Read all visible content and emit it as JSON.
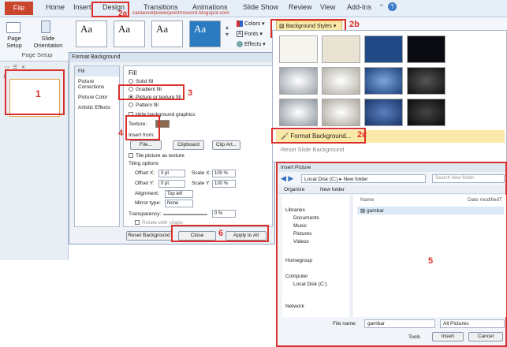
{
  "tabs": [
    "File",
    "Home",
    "Insert",
    "Design",
    "Transitions",
    "Animations",
    "Slide Show",
    "Review",
    "View",
    "Add-Ins"
  ],
  "watermark": "caraexcelpowerpointmsword.blogspot.com",
  "ribbon": {
    "page_setup": "Page\nSetup",
    "slide_orientation": "Slide\nOrientation",
    "group_label": "Page Setup",
    "theme_label": "Aa",
    "colors": "Colors",
    "fonts": "Fonts",
    "effects": "Effects",
    "bg_styles": "Background Styles"
  },
  "labels": {
    "l1": "1",
    "l2a": "2a",
    "l2b": "2b",
    "l2c": "2c",
    "l3": "3",
    "l4": "4",
    "l5": "5",
    "l6": "6"
  },
  "slidepane": {
    "slide_number": "1"
  },
  "format_bg": {
    "title": "Format Background",
    "nav": [
      "Fill",
      "Picture Corrections",
      "Picture Color",
      "Artistic Effects"
    ],
    "fill_heading": "Fill",
    "options": [
      "Solid fill",
      "Gradient fill",
      "Picture or texture fill",
      "Pattern fill"
    ],
    "hide_graphics": "Hide background graphics",
    "texture": "Texture:",
    "insert_from": "Insert from:",
    "file_btn": "File...",
    "clipboard_btn": "Clipboard",
    "clipart_btn": "Clip Art...",
    "tile": "Tile picture as texture",
    "tiling": "Tiling options",
    "offset_x": "Offset X:",
    "offset_x_val": "0 pt",
    "scale_x": "Scale X:",
    "scale_x_val": "100 %",
    "offset_y": "Offset Y:",
    "offset_y_val": "0 pt",
    "scale_y": "Scale Y:",
    "scale_y_val": "100 %",
    "alignment": "Alignment:",
    "alignment_val": "Top left",
    "mirror": "Mirror type:",
    "mirror_val": "None",
    "transparency": "Transparency:",
    "transparency_val": "0 %",
    "rotate": "Rotate with shape",
    "reset_btn": "Reset Background",
    "close_btn": "Close",
    "apply_all_btn": "Apply to All"
  },
  "gallery": {
    "format_bg_item": "Format Background...",
    "reset_item": "Reset Slide Background"
  },
  "insert_picture": {
    "title": "Insert Picture",
    "path": "Local Disk (C:) ▸ New folder",
    "search": "Search New folder",
    "organize": "Organize",
    "new_folder": "New folder",
    "col_name": "Name",
    "col_date": "Date modified",
    "col_t": "T",
    "file": "gambar",
    "nav": [
      "Libraries",
      "Documents",
      "Music",
      "Pictures",
      "Videos",
      "Homegroup",
      "Computer",
      "Local Disk (C:)",
      "Network"
    ],
    "filename_label": "File name:",
    "filename_val": "gambar",
    "filetype_val": "All Pictures",
    "tools": "Tools",
    "insert_btn": "Insert",
    "cancel_btn": "Cancel"
  }
}
